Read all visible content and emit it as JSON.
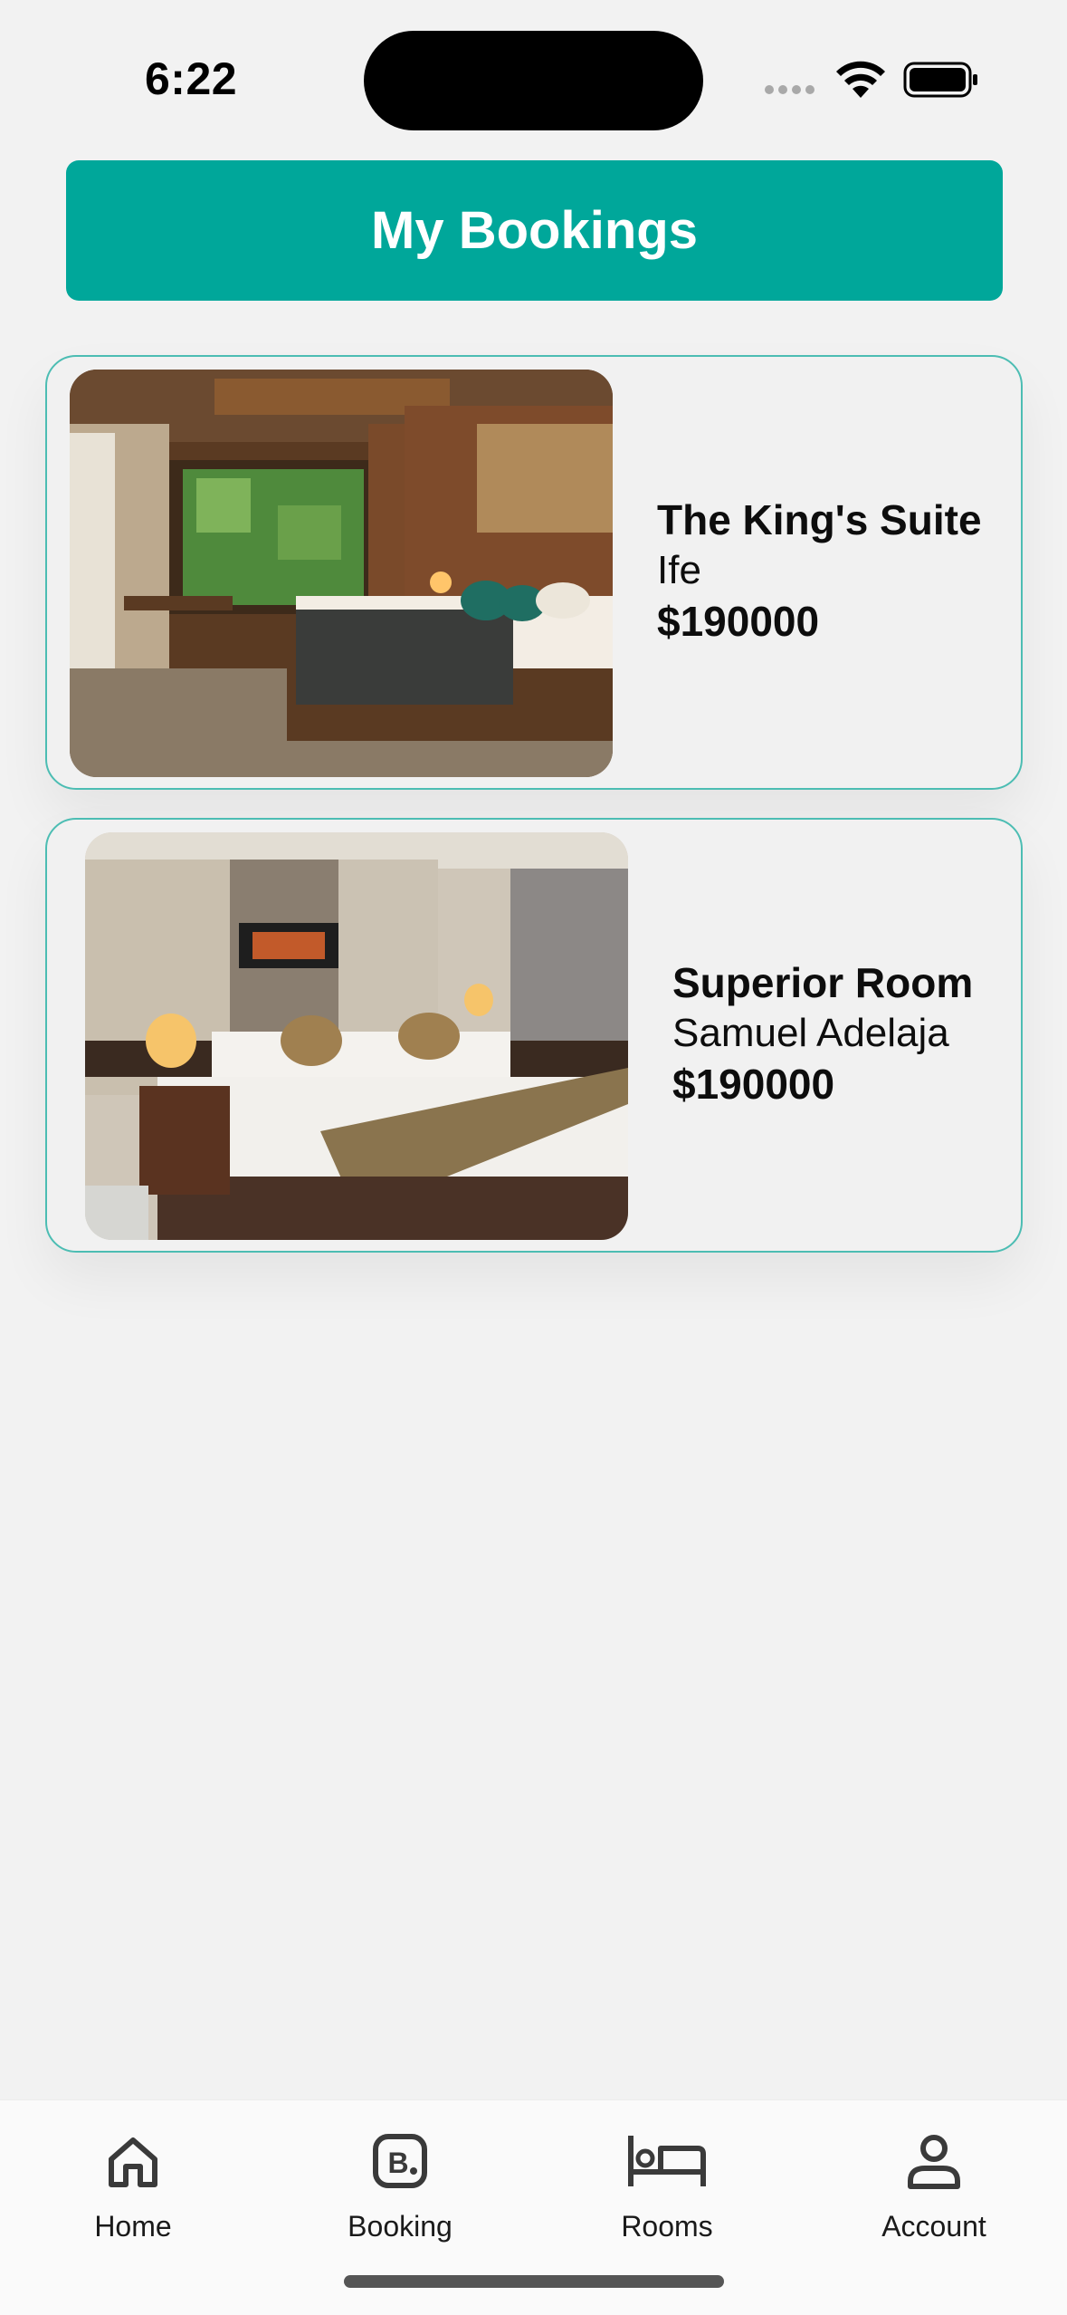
{
  "status_bar": {
    "time": "6:22"
  },
  "header": {
    "title": "My Bookings"
  },
  "bookings": [
    {
      "title": "The King's Suite",
      "location": "Ife",
      "price": "$190000"
    },
    {
      "title": "Superior Room",
      "location": "Samuel Adelaja",
      "price": "$190000"
    }
  ],
  "tabs": [
    {
      "label": "Home",
      "icon": "home-icon"
    },
    {
      "label": "Booking",
      "icon": "booking-icon"
    },
    {
      "label": "Rooms",
      "icon": "bed-icon"
    },
    {
      "label": "Account",
      "icon": "account-icon"
    }
  ],
  "colors": {
    "accent": "#00a79a",
    "card_border": "#4cbdb3",
    "background": "#f2f2f2"
  }
}
